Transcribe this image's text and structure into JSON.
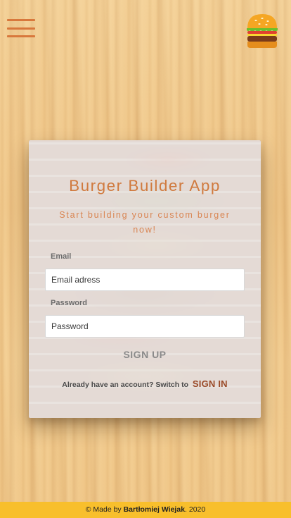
{
  "header": {
    "menu_icon": "hamburger-menu-icon",
    "logo_icon": "burger-logo-icon"
  },
  "card": {
    "title": "Burger Builder App",
    "subtitle": "Start building your custom burger now!",
    "email_label": "Email",
    "email_placeholder": "Email adress",
    "password_label": "Password",
    "password_placeholder": "Password",
    "signup_label": "SIGN UP",
    "switch_text": "Already have an account? Switch to",
    "signin_label": "SIGN IN"
  },
  "footer": {
    "prefix": "© Made by ",
    "author": "Bartłomiej Wiejak",
    "suffix": ". 2020"
  },
  "colors": {
    "accent": "#d07a3e",
    "signin": "#9a4a28",
    "footer_bg": "#f8bf2c",
    "menu": "#d8783c"
  }
}
